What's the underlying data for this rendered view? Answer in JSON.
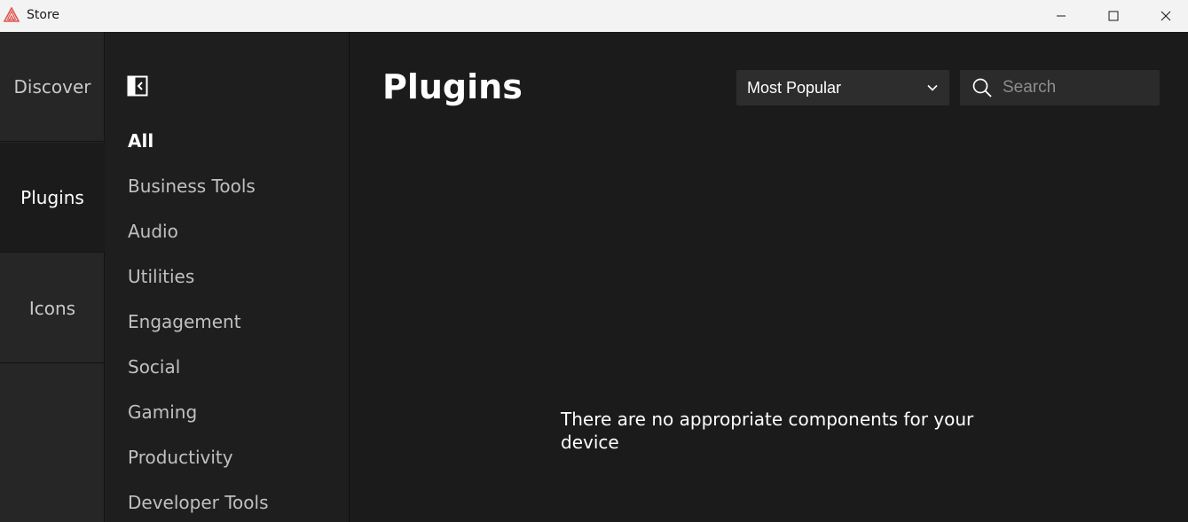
{
  "window": {
    "title": "Store"
  },
  "nav_rail": {
    "items": [
      {
        "label": "Discover",
        "active": false
      },
      {
        "label": "Plugins",
        "active": true
      },
      {
        "label": "Icons",
        "active": false
      }
    ]
  },
  "categories": {
    "items": [
      {
        "label": "All",
        "active": true
      },
      {
        "label": "Business Tools",
        "active": false
      },
      {
        "label": "Audio",
        "active": false
      },
      {
        "label": "Utilities",
        "active": false
      },
      {
        "label": "Engagement",
        "active": false
      },
      {
        "label": "Social",
        "active": false
      },
      {
        "label": "Gaming",
        "active": false
      },
      {
        "label": "Productivity",
        "active": false
      },
      {
        "label": "Developer Tools",
        "active": false
      }
    ]
  },
  "main": {
    "title": "Plugins",
    "sort": {
      "selected": "Most Popular"
    },
    "search": {
      "placeholder": "Search",
      "value": ""
    },
    "empty_message": "There are no appropriate components for your device"
  },
  "colors": {
    "accent_logo": "#e0574f",
    "background": "#1b1b1b",
    "titlebar": "#f3f3f3"
  }
}
